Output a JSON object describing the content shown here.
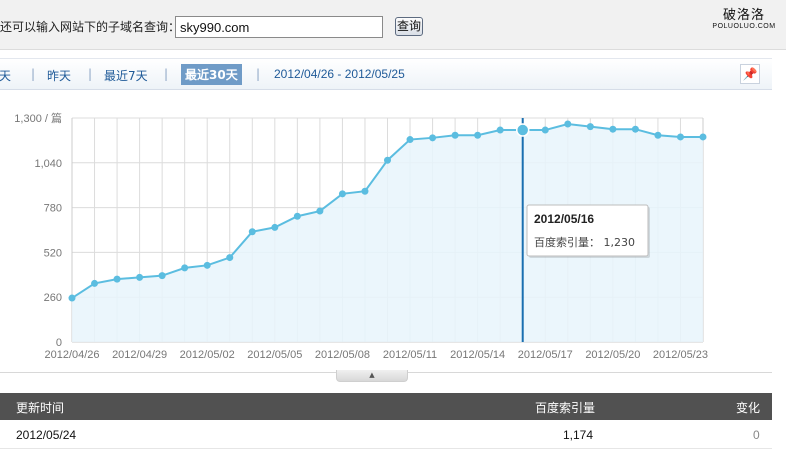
{
  "search": {
    "label": "还可以输入网站下的子域名查询：",
    "value": "sky990.com",
    "button_label": "查询"
  },
  "brand": {
    "name": "破洛洛",
    "sub": "POLUOLUO.COM"
  },
  "range_tabs": {
    "today": "天",
    "yesterday": "昨天",
    "last7": "最近7天",
    "last30": "最近30天",
    "active": "last30",
    "date_range": "2012/04/26 - 2012/05/25"
  },
  "pin_icon": "pin-icon",
  "chart_data": {
    "type": "area",
    "ylabel": "篇",
    "ylim": [
      0,
      1300
    ],
    "yticks": [
      0,
      260,
      520,
      780,
      1040,
      1300
    ],
    "ytick_labels": [
      "0",
      "260",
      "520",
      "780",
      "1,040",
      "1,300 / 篇"
    ],
    "grid": true,
    "x": [
      "2012/04/26",
      "2012/04/27",
      "2012/04/28",
      "2012/04/29",
      "2012/04/30",
      "2012/05/01",
      "2012/05/02",
      "2012/05/03",
      "2012/05/04",
      "2012/05/05",
      "2012/05/06",
      "2012/05/07",
      "2012/05/08",
      "2012/05/09",
      "2012/05/10",
      "2012/05/11",
      "2012/05/12",
      "2012/05/13",
      "2012/05/14",
      "2012/05/15",
      "2012/05/16",
      "2012/05/17",
      "2012/05/18",
      "2012/05/19",
      "2012/05/20",
      "2012/05/21",
      "2012/05/22",
      "2012/05/23",
      "2012/05/24"
    ],
    "xtick_labels": [
      "2012/04/26",
      "2012/04/29",
      "2012/05/02",
      "2012/05/05",
      "2012/05/08",
      "2012/05/11",
      "2012/05/14",
      "2012/05/17",
      "2012/05/20",
      "2012/05/23"
    ],
    "values": [
      255,
      340,
      365,
      375,
      385,
      430,
      445,
      490,
      640,
      665,
      730,
      760,
      860,
      875,
      1055,
      1175,
      1185,
      1200,
      1200,
      1230,
      1230,
      1230,
      1265,
      1250,
      1235,
      1235,
      1200,
      1190,
      1190
    ],
    "highlight": {
      "date": "2012/05/16",
      "label": "百度索引量",
      "value": "1,230"
    },
    "colors": {
      "line": "#5bbde0",
      "fill": "#e8f5fc",
      "grid": "#dcdcdc",
      "axis": "#cccccc",
      "cursor": "#1a6fb0"
    }
  },
  "table": {
    "headers": [
      "更新时间",
      "百度索引量",
      "变化"
    ],
    "rows": [
      {
        "date": "2012/05/24",
        "count": "1,174",
        "change": "0"
      }
    ]
  }
}
